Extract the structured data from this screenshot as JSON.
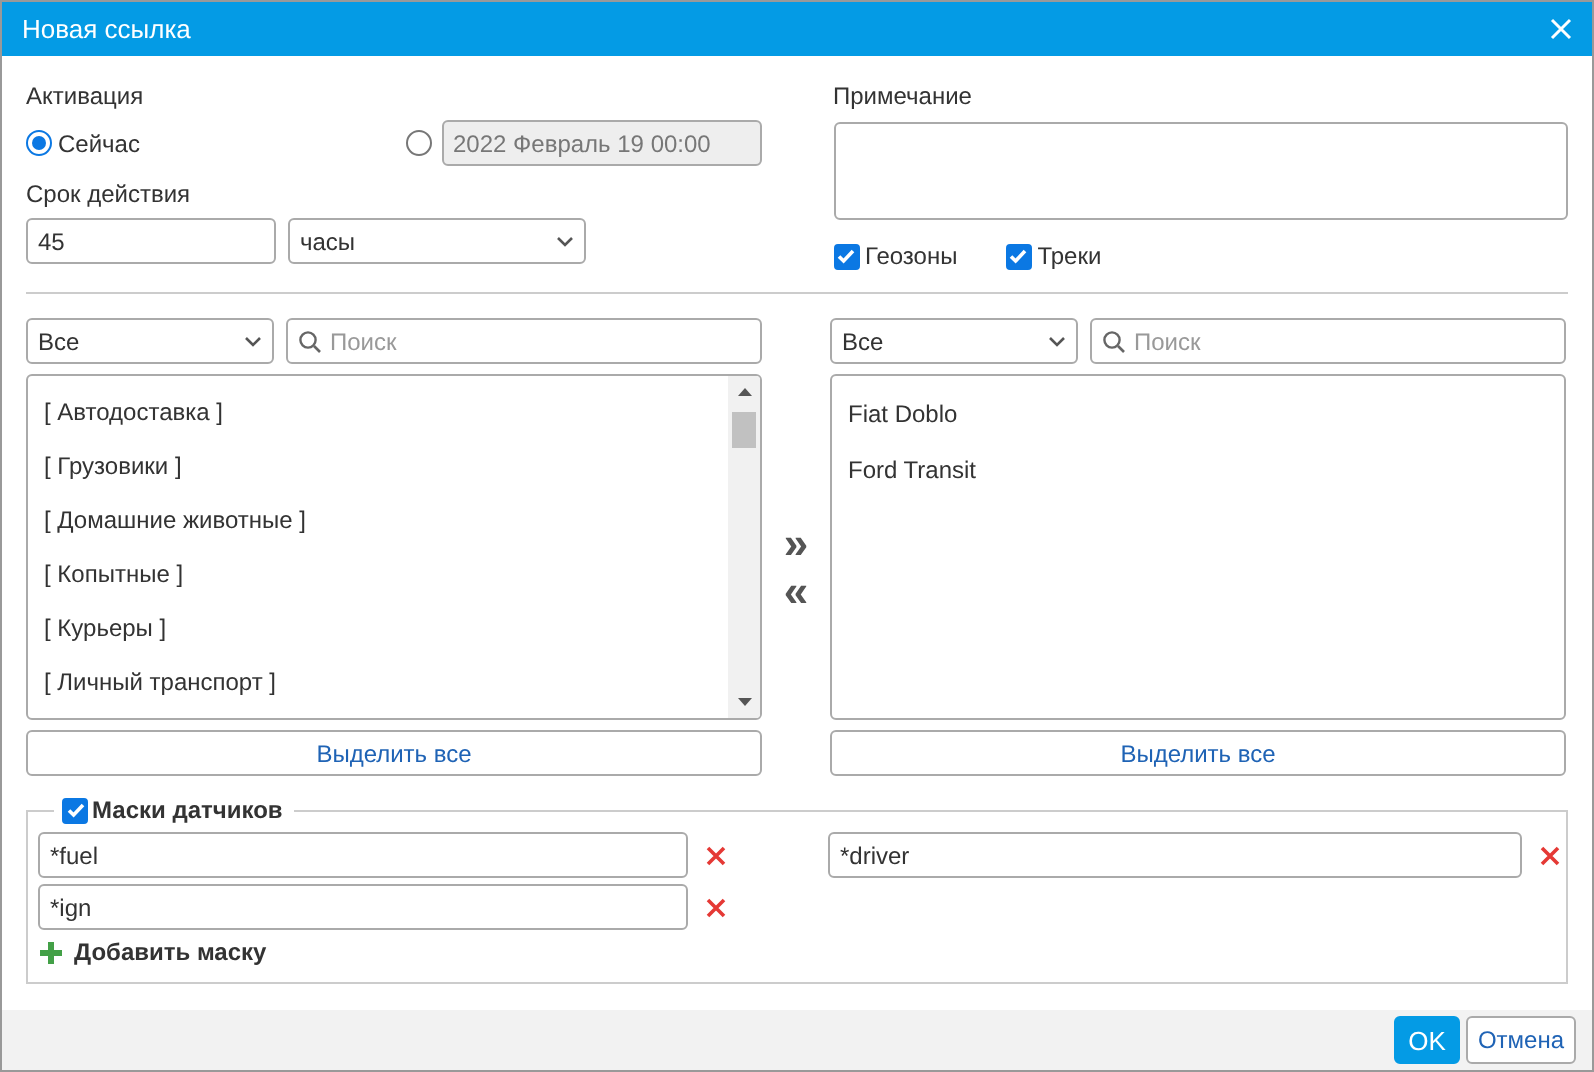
{
  "window": {
    "title": "Новая ссылка"
  },
  "activation": {
    "label": "Активация",
    "options": [
      {
        "kind": "now",
        "label": "Сейчас",
        "selected": true
      },
      {
        "kind": "date",
        "value": "2022 Февраль 19 00:00",
        "disabled": true,
        "selected": false
      }
    ]
  },
  "duration": {
    "label": "Срок действия",
    "value": "45",
    "unit": "часы"
  },
  "note": {
    "label": "Примечание"
  },
  "options": [
    {
      "label": "Геозоны",
      "checked": true
    },
    {
      "label": "Треки",
      "checked": true
    }
  ],
  "lists": [
    {
      "filter": "Все",
      "search": {
        "placeholder": "Поиск"
      },
      "items": [
        "[ Автодоставка ]",
        "[ Грузовики ]",
        "[ Домашние животные ]",
        "[ Копытные ]",
        "[ Курьеры ]",
        "[ Личный транспорт ]"
      ],
      "scrollable": true,
      "button": "Выделить все"
    },
    {
      "filter": "Все",
      "search": {
        "placeholder": "Поиск"
      },
      "items": [
        "Fiat Doblo",
        "Ford Transit"
      ],
      "scrollable": false,
      "button": "Выделить все"
    }
  ],
  "transfer": {
    "add": "»",
    "remove": "«"
  },
  "sensor_masks": {
    "label": "Маски датчиков",
    "checked": true,
    "columns": [
      {
        "masks": [
          "*fuel",
          "*ign"
        ]
      },
      {
        "masks": [
          "*driver"
        ]
      }
    ],
    "add_label": "Добавить маску"
  },
  "buttons": [
    {
      "label": "OK",
      "kind": "primary"
    },
    {
      "label": "Отмена",
      "kind": "secondary"
    }
  ]
}
